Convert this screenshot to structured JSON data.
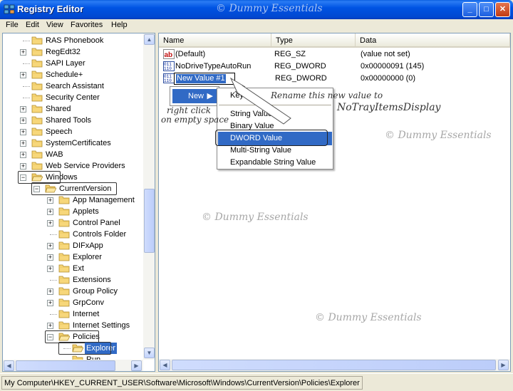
{
  "window": {
    "title": "Registry Editor",
    "watermark": "© Dummy Essentials",
    "minimize": "_",
    "maximize": "□",
    "close": "✕"
  },
  "menu": [
    "File",
    "Edit",
    "View",
    "Favorites",
    "Help"
  ],
  "tree": {
    "items": [
      {
        "label": "RAS Phonebook",
        "expander": ""
      },
      {
        "label": "RegEdt32",
        "expander": "+"
      },
      {
        "label": "SAPI Layer",
        "expander": ""
      },
      {
        "label": "Schedule+",
        "expander": "+"
      },
      {
        "label": "Search Assistant",
        "expander": ""
      },
      {
        "label": "Security Center",
        "expander": ""
      },
      {
        "label": "Shared",
        "expander": "+"
      },
      {
        "label": "Shared Tools",
        "expander": "+"
      },
      {
        "label": "Speech",
        "expander": "+"
      },
      {
        "label": "SystemCertificates",
        "expander": "+"
      },
      {
        "label": "WAB",
        "expander": "+"
      },
      {
        "label": "Web Service Providers",
        "expander": "+"
      },
      {
        "label": "Windows",
        "expander": "−"
      },
      {
        "label": "CurrentVersion",
        "expander": "−"
      },
      {
        "label": "App Management",
        "expander": "+"
      },
      {
        "label": "Applets",
        "expander": "+"
      },
      {
        "label": "Control Panel",
        "expander": "+"
      },
      {
        "label": "Controls Folder",
        "expander": ""
      },
      {
        "label": "DIFxApp",
        "expander": "+"
      },
      {
        "label": "Explorer",
        "expander": "+"
      },
      {
        "label": "Ext",
        "expander": "+"
      },
      {
        "label": "Extensions",
        "expander": ""
      },
      {
        "label": "Group Policy",
        "expander": "+"
      },
      {
        "label": "GrpConv",
        "expander": "+"
      },
      {
        "label": "Internet",
        "expander": ""
      },
      {
        "label": "Internet Settings",
        "expander": "+"
      },
      {
        "label": "Policies",
        "expander": "−"
      },
      {
        "label": "Explorer",
        "expander": ""
      },
      {
        "label": "Run",
        "expander": ""
      }
    ]
  },
  "list": {
    "headers": {
      "name": "Name",
      "type": "Type",
      "data": "Data"
    },
    "rows": [
      {
        "name": "(Default)",
        "type": "REG_SZ",
        "data": "(value not set)",
        "icon": "ab-icon"
      },
      {
        "name": "NoDriveTypeAutoRun",
        "type": "REG_DWORD",
        "data": "0x00000091 (145)",
        "icon": "binary-icon"
      },
      {
        "name": "New Value #1",
        "type": "REG_DWORD",
        "data": "0x00000000 (0)",
        "icon": "binary-icon"
      }
    ]
  },
  "context_menu": {
    "new": "New",
    "items": [
      "Key",
      "String Value",
      "Binary Value",
      "DWORD Value",
      "Multi-String Value",
      "Expandable String Value"
    ]
  },
  "annotations": {
    "right_click_1": "right click",
    "right_click_2": "on empty space",
    "rename_1": "Rename this new value to",
    "rename_2": "NoTrayItemsDisplay"
  },
  "status": "My Computer\\HKEY_CURRENT_USER\\Software\\Microsoft\\Windows\\CurrentVersion\\Policies\\Explorer"
}
